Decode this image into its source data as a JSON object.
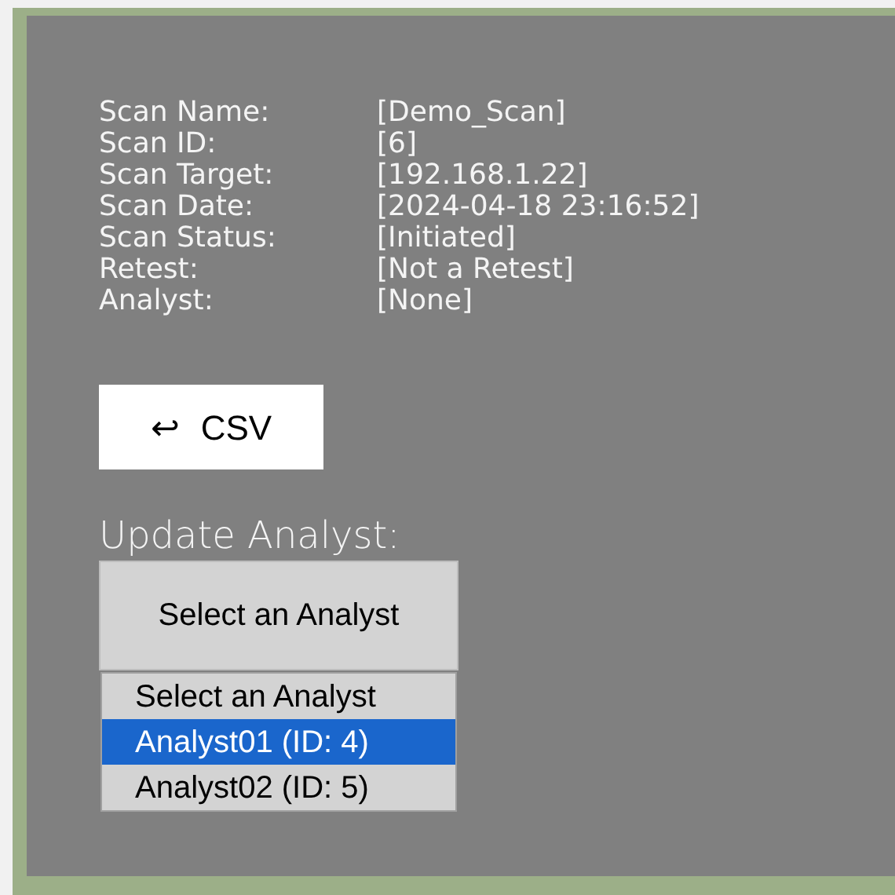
{
  "details": [
    {
      "label": "Scan Name:",
      "value": "[Demo_Scan]"
    },
    {
      "label": "Scan ID:",
      "value": "[6]"
    },
    {
      "label": "Scan Target:",
      "value": "[192.168.1.22]"
    },
    {
      "label": "Scan Date:",
      "value": "[2024-04-18 23:16:52]"
    },
    {
      "label": "Scan Status:",
      "value": "[Initiated]"
    },
    {
      "label": "Retest:",
      "value": "[Not a Retest]"
    },
    {
      "label": "Analyst:",
      "value": "[None]"
    }
  ],
  "csv_button": {
    "icon": "↩",
    "label": "CSV"
  },
  "update_analyst": {
    "heading": "Update Analyst:",
    "select": {
      "value": "Select an Analyst"
    },
    "options": [
      {
        "label": "Select an Analyst",
        "selected": false
      },
      {
        "label": "Analyst01 (ID: 4)",
        "selected": true
      },
      {
        "label": "Analyst02 (ID: 5)",
        "selected": false
      }
    ]
  }
}
